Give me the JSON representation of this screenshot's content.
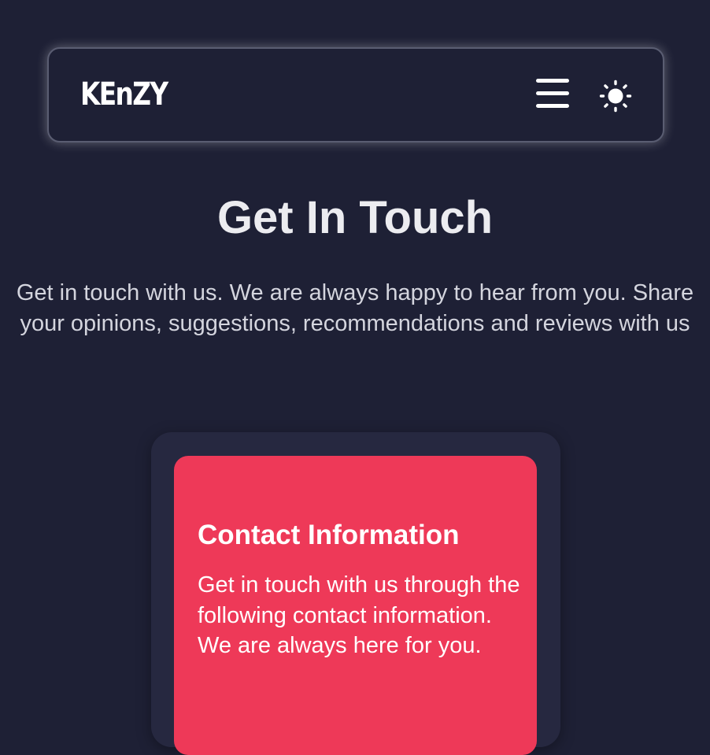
{
  "navbar": {
    "logo": "KEnZY",
    "menu_icon": "hamburger-menu-icon",
    "theme_icon": "sun-icon"
  },
  "page": {
    "title": "Get In Touch",
    "intro": "Get in touch with us. We are always happy to hear from you. Share your opinions, suggestions, recommendations and reviews with us"
  },
  "contact_info": {
    "title": "Contact Information",
    "text": "Get in touch with us through the following contact information. We are always here for you."
  },
  "colors": {
    "background": "#1e2035",
    "card": "#262840",
    "accent": "#ee3958",
    "text": "#ffffff"
  }
}
